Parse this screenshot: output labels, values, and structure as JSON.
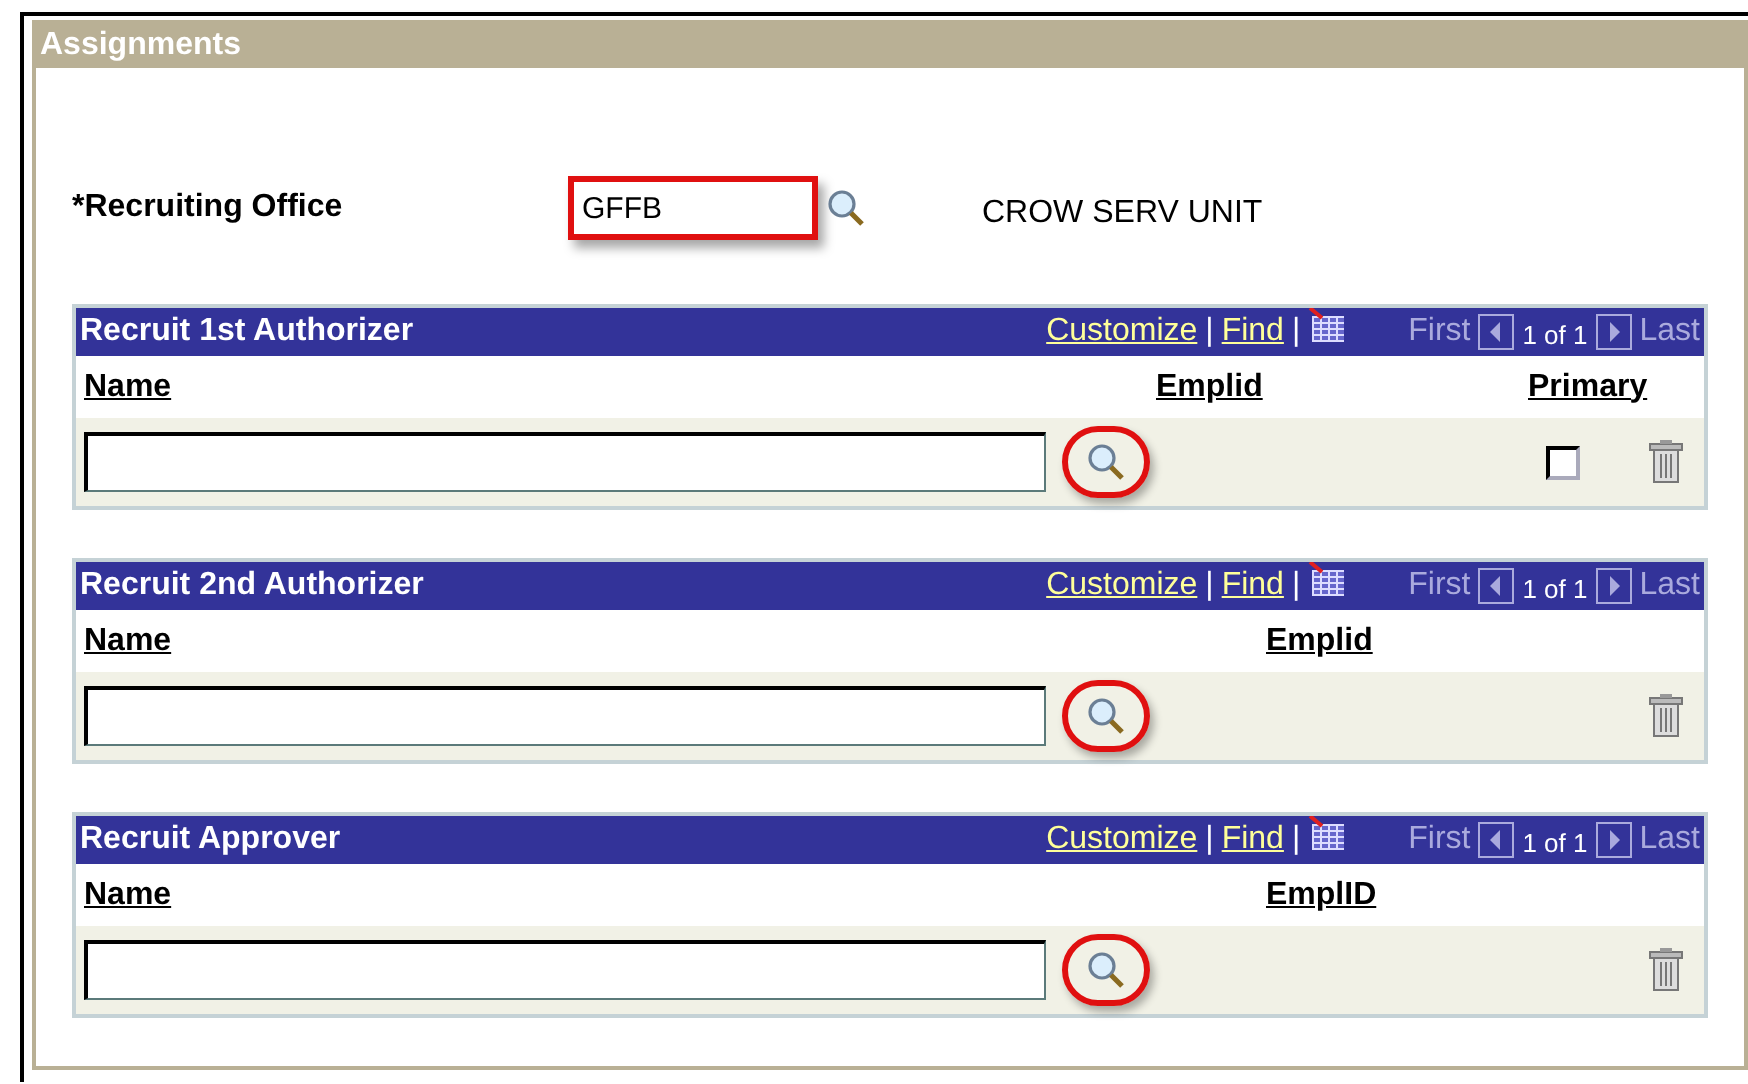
{
  "section": {
    "title": "Assignments"
  },
  "office": {
    "label": "Recruiting Office",
    "required_mark": "*",
    "value": "GFFB",
    "highlighted": true,
    "description": "CROW SERV UNIT"
  },
  "grids": [
    {
      "title": "Recruit 1st Authorizer",
      "toolbar": [
        {
          "kind": "link",
          "text": "Customize"
        },
        {
          "kind": "sep",
          "text": "|"
        },
        {
          "kind": "link",
          "text": "Find"
        },
        {
          "kind": "sep",
          "text": "|"
        },
        {
          "kind": "grid-icon"
        }
      ],
      "nav": {
        "first": "First",
        "counter": "1 of 1",
        "last": "Last"
      },
      "columns": [
        {
          "label": "Name",
          "kind": "name"
        },
        {
          "label": "Emplid",
          "kind": "emplid"
        },
        {
          "label": "Primary",
          "kind": "primary"
        }
      ],
      "row": {
        "lookup_circled": true,
        "primary_checked": false
      }
    },
    {
      "title": "Recruit 2nd Authorizer",
      "toolbar": [
        {
          "kind": "link",
          "text": "Customize"
        },
        {
          "kind": "sep",
          "text": "|"
        },
        {
          "kind": "link",
          "text": "Find"
        },
        {
          "kind": "sep",
          "text": "|"
        },
        {
          "kind": "grid-icon"
        }
      ],
      "nav": {
        "first": "First",
        "counter": "1 of 1",
        "last": "Last"
      },
      "columns": [
        {
          "label": "Name",
          "kind": "name"
        },
        {
          "label": "Emplid",
          "kind": "emplid"
        }
      ],
      "row": {
        "lookup_circled": true
      }
    },
    {
      "title": "Recruit Approver",
      "toolbar": [
        {
          "kind": "link",
          "text": "Customize"
        },
        {
          "kind": "sep",
          "text": "|"
        },
        {
          "kind": "link",
          "text": "Find"
        },
        {
          "kind": "sep",
          "text": "|"
        },
        {
          "kind": "grid-icon"
        }
      ],
      "nav": {
        "first": "First",
        "counter": "1 of 1",
        "last": "Last"
      },
      "columns": [
        {
          "label": "Name",
          "kind": "name"
        },
        {
          "label": "EmplID",
          "kind": "emplid"
        }
      ],
      "row": {
        "lookup_circled": true
      }
    }
  ]
}
